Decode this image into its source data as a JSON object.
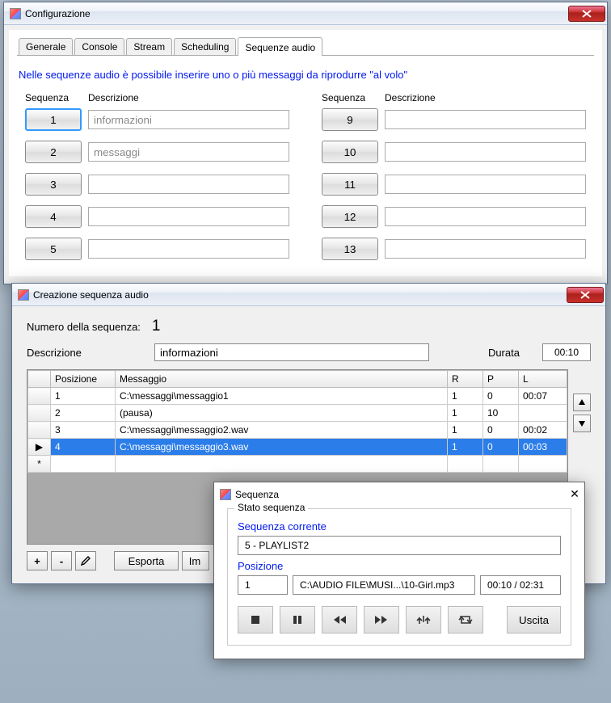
{
  "win_config": {
    "title": "Configurazione",
    "tabs": [
      "Generale",
      "Console",
      "Stream",
      "Scheduling",
      "Sequenze audio"
    ],
    "active_tab": 4,
    "info_text": "Nelle sequenze audio è possibile inserire uno o più messaggi da riprodurre \"al volo\"",
    "col_header_seq": "Sequenza",
    "col_header_desc": "Descrizione",
    "left": [
      {
        "n": "1",
        "desc": "informazioni"
      },
      {
        "n": "2",
        "desc": "messaggi"
      },
      {
        "n": "3",
        "desc": ""
      },
      {
        "n": "4",
        "desc": ""
      },
      {
        "n": "5",
        "desc": ""
      }
    ],
    "right": [
      {
        "n": "9",
        "desc": ""
      },
      {
        "n": "10",
        "desc": ""
      },
      {
        "n": "11",
        "desc": ""
      },
      {
        "n": "12",
        "desc": ""
      },
      {
        "n": "13",
        "desc": ""
      }
    ]
  },
  "win_create": {
    "title": "Creazione sequenza audio",
    "num_label": "Numero della sequenza:",
    "num_value": "1",
    "desc_label": "Descrizione",
    "desc_value": "informazioni",
    "durata_label": "Durata",
    "durata_value": "00:10",
    "columns": {
      "pos": "Posizione",
      "msg": "Messaggio",
      "r": "R",
      "p": "P",
      "l": "L"
    },
    "rows": [
      {
        "marker": "",
        "pos": "1",
        "msg": "C:\\messaggi\\messaggio1",
        "r": "1",
        "p": "0",
        "l": "00:07"
      },
      {
        "marker": "",
        "pos": "2",
        "msg": "(pausa)",
        "r": "1",
        "p": "10",
        "l": ""
      },
      {
        "marker": "",
        "pos": "3",
        "msg": "C:\\messaggi\\messaggio2.wav",
        "r": "1",
        "p": "0",
        "l": "00:02"
      },
      {
        "marker": "▶",
        "pos": "4",
        "msg": "C:\\messaggi\\messaggio3.wav",
        "r": "1",
        "p": "0",
        "l": "00:03",
        "selected": true
      },
      {
        "marker": "*",
        "pos": "",
        "msg": "",
        "r": "",
        "p": "",
        "l": ""
      }
    ],
    "toolbar": {
      "add": "+",
      "remove": "-",
      "edit": "✎",
      "esporta": "Esporta",
      "importa": "Im"
    }
  },
  "win_seq": {
    "title": "Sequenza",
    "group_label": "Stato sequenza",
    "current_label": "Sequenza corrente",
    "current_value": "5 - PLAYLIST2",
    "pos_label": "Posizione",
    "pos_index": "1",
    "pos_file": "C:\\AUDIO FILE\\MUSI...\\10-Girl.mp3",
    "pos_time": "00:10 / 02:31",
    "uscita": "Uscita"
  }
}
